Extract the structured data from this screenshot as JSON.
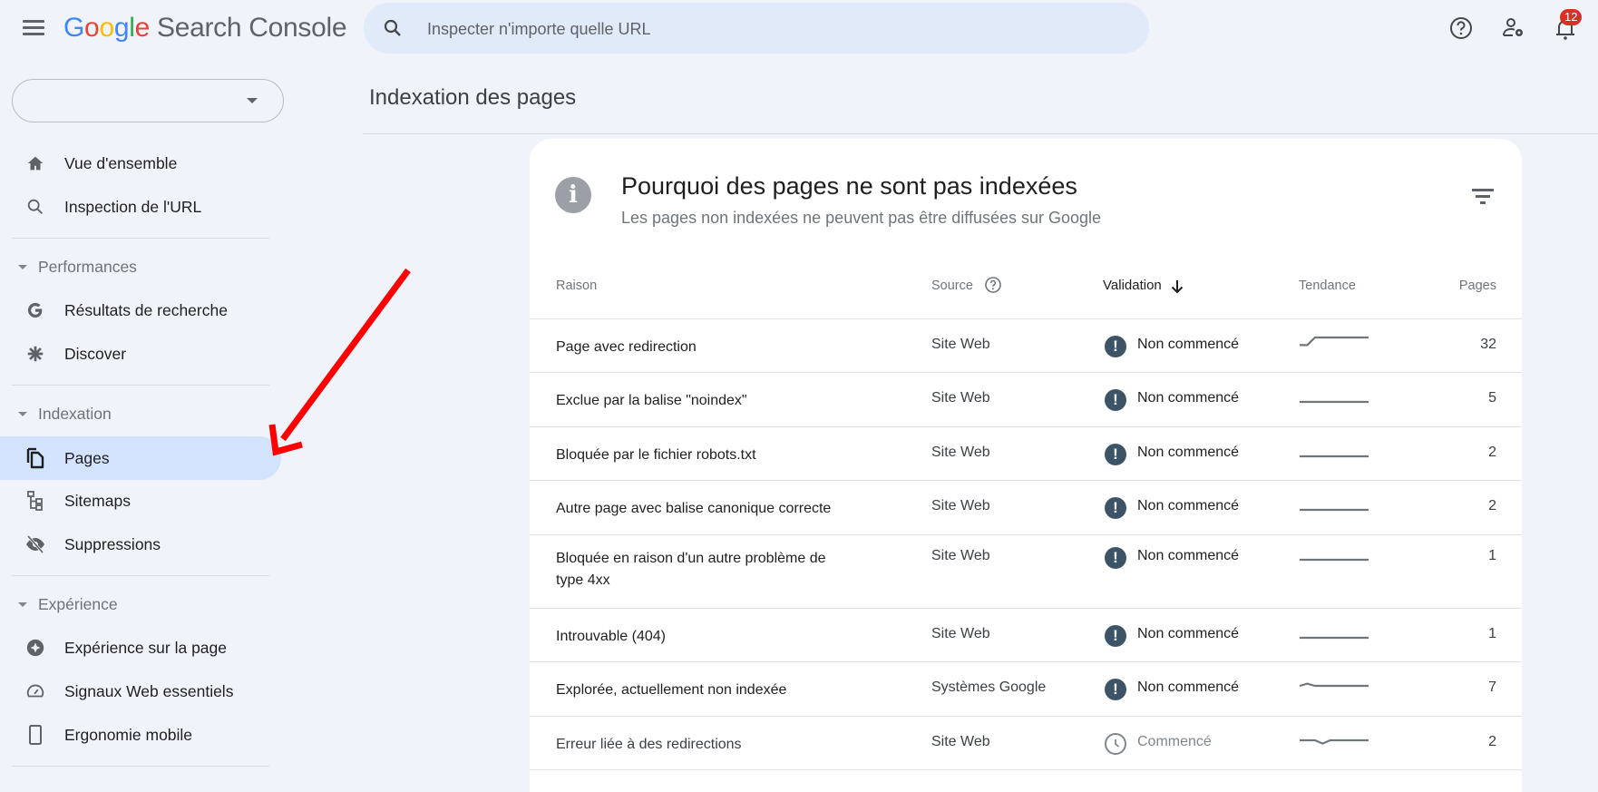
{
  "header": {
    "logo_letters": [
      "G",
      "o",
      "o",
      "g",
      "l",
      "e"
    ],
    "product_name": "Search Console",
    "search_placeholder": "Inspecter n'importe quelle URL",
    "icons": [
      "menu-icon",
      "search-icon",
      "help-icon",
      "user-settings-icon",
      "notifications-bell-icon"
    ],
    "notification_count": "12"
  },
  "sidebar": {
    "property_selector_value": "",
    "items": [
      {
        "label": "Vue d'ensemble",
        "icon": "home-icon"
      },
      {
        "label": "Inspection de l'URL",
        "icon": "search-icon"
      }
    ],
    "sections": [
      {
        "label": "Performances",
        "items": [
          {
            "label": "Résultats de recherche",
            "icon": "google-g-icon"
          },
          {
            "label": "Discover",
            "icon": "asterisk-icon"
          }
        ]
      },
      {
        "label": "Indexation",
        "items": [
          {
            "label": "Pages",
            "icon": "pages-icon",
            "active": true
          },
          {
            "label": "Sitemaps",
            "icon": "sitemap-icon"
          },
          {
            "label": "Suppressions",
            "icon": "eye-off-icon"
          }
        ]
      },
      {
        "label": "Expérience",
        "items": [
          {
            "label": "Expérience sur la page",
            "icon": "page-experience-icon"
          },
          {
            "label": "Signaux Web essentiels",
            "icon": "speed-gauge-icon"
          },
          {
            "label": "Ergonomie mobile",
            "icon": "smartphone-icon"
          }
        ]
      }
    ]
  },
  "main": {
    "page_title": "Indexation des pages",
    "card": {
      "title": "Pourquoi des pages ne sont pas indexées",
      "subtitle": "Les pages non indexées ne peuvent pas être diffusées sur Google",
      "columns": {
        "reason": "Raison",
        "source": "Source",
        "validation": "Validation",
        "trend": "Tendance",
        "pages": "Pages"
      },
      "sorted_column": "validation",
      "sort_direction": "descending",
      "rows": [
        {
          "reason": "Page avec redirection",
          "source": "Site Web",
          "validation": "Non commencé",
          "status": "not-started",
          "pages": "32",
          "trend": [
            0.3,
            0.3,
            1,
            1,
            1,
            1,
            1,
            1,
            1,
            1
          ]
        },
        {
          "reason": "Exclue par la balise \"noindex\"",
          "source": "Site Web",
          "validation": "Non commencé",
          "status": "not-started",
          "pages": "5",
          "trend": [
            0,
            0,
            0,
            0,
            0,
            0,
            0,
            0,
            0,
            0
          ]
        },
        {
          "reason": "Bloquée par le fichier robots.txt",
          "source": "Site Web",
          "validation": "Non commencé",
          "status": "not-started",
          "pages": "2",
          "trend": [
            0,
            0,
            0,
            0,
            0,
            0,
            0,
            0,
            0,
            0
          ]
        },
        {
          "reason": "Autre page avec balise canonique correcte",
          "source": "Site Web",
          "validation": "Non commencé",
          "status": "not-started",
          "pages": "2",
          "trend": [
            0,
            0,
            0,
            0,
            0,
            0,
            0,
            0,
            0,
            0
          ]
        },
        {
          "reason": "Bloquée en raison d'un autre problème de type 4xx",
          "source": "Site Web",
          "validation": "Non commencé",
          "status": "not-started",
          "pages": "1",
          "trend": [
            0,
            0,
            0,
            0,
            0,
            0,
            0,
            0,
            0,
            0
          ]
        },
        {
          "reason": "Introuvable (404)",
          "source": "Site Web",
          "validation": "Non commencé",
          "status": "not-started",
          "pages": "1",
          "trend": [
            0,
            0,
            0,
            0,
            0,
            0,
            0,
            0,
            0,
            0
          ]
        },
        {
          "reason": "Explorée, actuellement non indexée",
          "source": "Systèmes Google",
          "validation": "Non commencé",
          "status": "not-started",
          "pages": "7",
          "trend": [
            0.5,
            0.7,
            0.5,
            0.5,
            0.5,
            0.5,
            0.5,
            0.5,
            0.5,
            0.5
          ]
        },
        {
          "reason": "Erreur liée à des redirections",
          "source": "Site Web",
          "validation": "Commencé",
          "status": "started",
          "pages": "2",
          "trend": [
            0.5,
            0.5,
            0.5,
            0.2,
            0.5,
            0.5,
            0.5,
            0.5,
            0.5,
            0.5
          ]
        }
      ]
    }
  },
  "annotation": {
    "type": "red-arrow",
    "points_to": "sidebar-item-pages",
    "color": "#ff0000"
  },
  "colors": {
    "accent_active_bg": "#d3e3fd",
    "status_not_started": "#3d5466",
    "badge": "#d93025",
    "page_bg": "#f0f4fa"
  }
}
